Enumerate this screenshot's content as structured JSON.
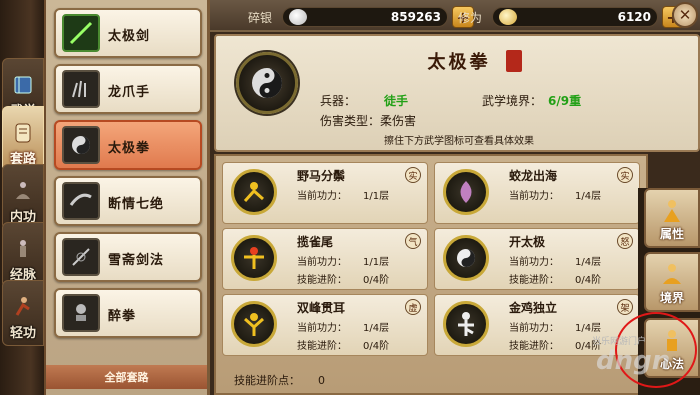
{
  "left_nav": [
    {
      "label": "武学",
      "icon": "book-icon"
    },
    {
      "label": "套路",
      "icon": "scroll-icon"
    },
    {
      "label": "内功",
      "icon": "meditation-icon"
    },
    {
      "label": "经脉",
      "icon": "meridian-figure-icon"
    },
    {
      "label": "轻功",
      "icon": "running-figure-icon"
    }
  ],
  "skill_list": [
    {
      "name": "太极剑"
    },
    {
      "name": "龙爪手"
    },
    {
      "name": "太极拳"
    },
    {
      "name": "断情七绝"
    },
    {
      "name": "雪斋剑法"
    },
    {
      "name": "醉拳"
    }
  ],
  "all_routines_label": "全部套路",
  "resources": {
    "silver_label": "碎银",
    "silver_value": "859263",
    "cultivation_label": "修为",
    "cultivation_value": "6120"
  },
  "detail": {
    "title": "太极拳",
    "weapon_label": "兵器：",
    "weapon_value": "徒手",
    "realm_label": "武学境界：",
    "realm_value": "6/9重",
    "damage_label": "伤害类型：",
    "damage_value": "柔伤害",
    "hint": "擦住下方武学图标可查看具体效果"
  },
  "moves": [
    {
      "name": "野马分鬃",
      "type": "实",
      "power_label": "当前功力：",
      "power": "1/1层"
    },
    {
      "name": "蛟龙出海",
      "type": "实",
      "power_label": "当前功力：",
      "power": "1/4层"
    },
    {
      "name": "揽雀尾",
      "type": "气",
      "power_label": "当前功力：",
      "power": "1/1层",
      "prog_label": "技能进阶：",
      "prog": "0/4阶"
    },
    {
      "name": "开太极",
      "type": "怒",
      "power_label": "当前功力：",
      "power": "1/4层",
      "prog_label": "技能进阶：",
      "prog": "0/4阶"
    },
    {
      "name": "双峰贯耳",
      "type": "虚",
      "power_label": "当前功力：",
      "power": "1/4层",
      "prog_label": "技能进阶：",
      "prog": "0/4阶"
    },
    {
      "name": "金鸡独立",
      "type": "架",
      "power_label": "当前功力：",
      "power": "1/4层",
      "prog_label": "技能进阶：",
      "prog": "0/4阶"
    }
  ],
  "points_label": "技能进阶点：",
  "points_value": "0",
  "side_tabs": [
    {
      "label": "属性",
      "icon": "character-figure-icon"
    },
    {
      "label": "境界",
      "icon": "meditating-figure-icon"
    },
    {
      "label": "心法",
      "icon": "sage-figure-icon"
    }
  ],
  "watermark": {
    "line1": "当乐网游门户",
    "line2": "dngn"
  },
  "colors": {
    "accent_green": "#22a016",
    "highlight_red": "#e01818",
    "active_tab": "#e07a4e"
  }
}
